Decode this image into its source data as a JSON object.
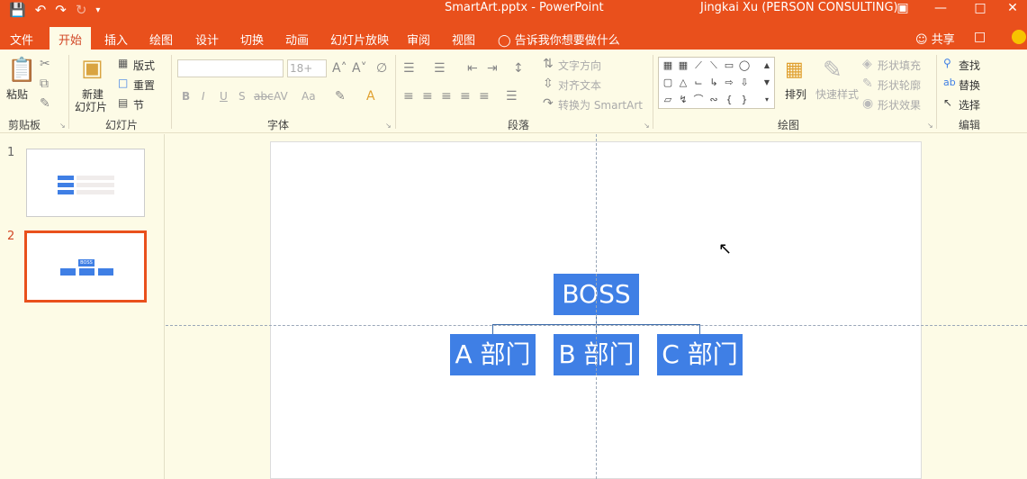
{
  "app": {
    "doc_title": "SmartArt.pptx  -  PowerPoint",
    "user": "Jingkai Xu (PERSON CONSULTING)"
  },
  "qat": {
    "save_icon": "save-icon",
    "undo_icon": "undo-icon",
    "redo_icon": "redo-icon",
    "repeat_icon": "repeat-icon",
    "customize_icon": "customize-qat-icon"
  },
  "tabs": [
    {
      "label": "文件"
    },
    {
      "label": "开始"
    },
    {
      "label": "插入"
    },
    {
      "label": "绘图"
    },
    {
      "label": "设计"
    },
    {
      "label": "切换"
    },
    {
      "label": "动画"
    },
    {
      "label": "幻灯片放映"
    },
    {
      "label": "审阅"
    },
    {
      "label": "视图"
    }
  ],
  "tellme": "告诉我你想要做什么",
  "share": "共享",
  "ribbon": {
    "clipboard": {
      "paste": "粘贴",
      "label": "剪贴板"
    },
    "slides": {
      "new_slide_line1": "新建",
      "new_slide_line2": "幻灯片",
      "layout": "版式",
      "reset": "重置",
      "section": "节",
      "label": "幻灯片"
    },
    "font": {
      "size": "18+",
      "label": "字体",
      "bold": "B",
      "italic": "I",
      "underline": "U",
      "shadow": "S",
      "strike": "abc",
      "spacing": "AV",
      "case": "Aa"
    },
    "paragraph": {
      "text_direction": "文字方向",
      "align_text": "对齐文本",
      "convert_smartart": "转换为 SmartArt",
      "label": "段落"
    },
    "drawing": {
      "arrange": "排列",
      "quick_styles": "快速样式",
      "shape_fill": "形状填充",
      "shape_outline": "形状轮廓",
      "shape_effects": "形状效果",
      "label": "绘图"
    },
    "editing": {
      "find": "查找",
      "replace": "替换",
      "select": "选择",
      "label": "编辑"
    }
  },
  "thumbnails": [
    {
      "number": "1"
    },
    {
      "number": "2"
    }
  ],
  "thumb2_text": {
    "boss": "BOSS"
  },
  "smartart": {
    "top": "BOSS",
    "children": [
      "A 部门",
      "B 部门",
      "C 部门"
    ]
  },
  "colors": {
    "accent": "#e9501c",
    "smartart_fill": "#3f7fe5",
    "background": "#fdfbe6"
  }
}
